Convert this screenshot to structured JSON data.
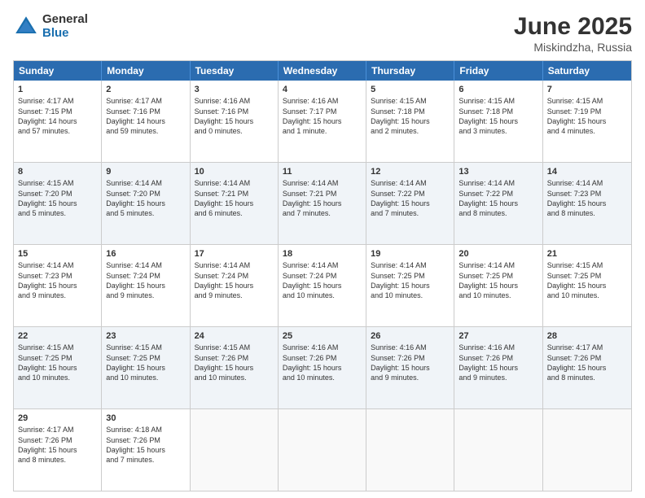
{
  "logo": {
    "general": "General",
    "blue": "Blue"
  },
  "title": "June 2025",
  "location": "Miskindzha, Russia",
  "header_days": [
    "Sunday",
    "Monday",
    "Tuesday",
    "Wednesday",
    "Thursday",
    "Friday",
    "Saturday"
  ],
  "rows": [
    [
      {
        "day": "1",
        "text": "Sunrise: 4:17 AM\nSunset: 7:15 PM\nDaylight: 14 hours\nand 57 minutes."
      },
      {
        "day": "2",
        "text": "Sunrise: 4:17 AM\nSunset: 7:16 PM\nDaylight: 14 hours\nand 59 minutes."
      },
      {
        "day": "3",
        "text": "Sunrise: 4:16 AM\nSunset: 7:16 PM\nDaylight: 15 hours\nand 0 minutes."
      },
      {
        "day": "4",
        "text": "Sunrise: 4:16 AM\nSunset: 7:17 PM\nDaylight: 15 hours\nand 1 minute."
      },
      {
        "day": "5",
        "text": "Sunrise: 4:15 AM\nSunset: 7:18 PM\nDaylight: 15 hours\nand 2 minutes."
      },
      {
        "day": "6",
        "text": "Sunrise: 4:15 AM\nSunset: 7:18 PM\nDaylight: 15 hours\nand 3 minutes."
      },
      {
        "day": "7",
        "text": "Sunrise: 4:15 AM\nSunset: 7:19 PM\nDaylight: 15 hours\nand 4 minutes."
      }
    ],
    [
      {
        "day": "8",
        "text": "Sunrise: 4:15 AM\nSunset: 7:20 PM\nDaylight: 15 hours\nand 5 minutes."
      },
      {
        "day": "9",
        "text": "Sunrise: 4:14 AM\nSunset: 7:20 PM\nDaylight: 15 hours\nand 5 minutes."
      },
      {
        "day": "10",
        "text": "Sunrise: 4:14 AM\nSunset: 7:21 PM\nDaylight: 15 hours\nand 6 minutes."
      },
      {
        "day": "11",
        "text": "Sunrise: 4:14 AM\nSunset: 7:21 PM\nDaylight: 15 hours\nand 7 minutes."
      },
      {
        "day": "12",
        "text": "Sunrise: 4:14 AM\nSunset: 7:22 PM\nDaylight: 15 hours\nand 7 minutes."
      },
      {
        "day": "13",
        "text": "Sunrise: 4:14 AM\nSunset: 7:22 PM\nDaylight: 15 hours\nand 8 minutes."
      },
      {
        "day": "14",
        "text": "Sunrise: 4:14 AM\nSunset: 7:23 PM\nDaylight: 15 hours\nand 8 minutes."
      }
    ],
    [
      {
        "day": "15",
        "text": "Sunrise: 4:14 AM\nSunset: 7:23 PM\nDaylight: 15 hours\nand 9 minutes."
      },
      {
        "day": "16",
        "text": "Sunrise: 4:14 AM\nSunset: 7:24 PM\nDaylight: 15 hours\nand 9 minutes."
      },
      {
        "day": "17",
        "text": "Sunrise: 4:14 AM\nSunset: 7:24 PM\nDaylight: 15 hours\nand 9 minutes."
      },
      {
        "day": "18",
        "text": "Sunrise: 4:14 AM\nSunset: 7:24 PM\nDaylight: 15 hours\nand 10 minutes."
      },
      {
        "day": "19",
        "text": "Sunrise: 4:14 AM\nSunset: 7:25 PM\nDaylight: 15 hours\nand 10 minutes."
      },
      {
        "day": "20",
        "text": "Sunrise: 4:14 AM\nSunset: 7:25 PM\nDaylight: 15 hours\nand 10 minutes."
      },
      {
        "day": "21",
        "text": "Sunrise: 4:15 AM\nSunset: 7:25 PM\nDaylight: 15 hours\nand 10 minutes."
      }
    ],
    [
      {
        "day": "22",
        "text": "Sunrise: 4:15 AM\nSunset: 7:25 PM\nDaylight: 15 hours\nand 10 minutes."
      },
      {
        "day": "23",
        "text": "Sunrise: 4:15 AM\nSunset: 7:25 PM\nDaylight: 15 hours\nand 10 minutes."
      },
      {
        "day": "24",
        "text": "Sunrise: 4:15 AM\nSunset: 7:26 PM\nDaylight: 15 hours\nand 10 minutes."
      },
      {
        "day": "25",
        "text": "Sunrise: 4:16 AM\nSunset: 7:26 PM\nDaylight: 15 hours\nand 10 minutes."
      },
      {
        "day": "26",
        "text": "Sunrise: 4:16 AM\nSunset: 7:26 PM\nDaylight: 15 hours\nand 9 minutes."
      },
      {
        "day": "27",
        "text": "Sunrise: 4:16 AM\nSunset: 7:26 PM\nDaylight: 15 hours\nand 9 minutes."
      },
      {
        "day": "28",
        "text": "Sunrise: 4:17 AM\nSunset: 7:26 PM\nDaylight: 15 hours\nand 8 minutes."
      }
    ],
    [
      {
        "day": "29",
        "text": "Sunrise: 4:17 AM\nSunset: 7:26 PM\nDaylight: 15 hours\nand 8 minutes."
      },
      {
        "day": "30",
        "text": "Sunrise: 4:18 AM\nSunset: 7:26 PM\nDaylight: 15 hours\nand 7 minutes."
      },
      {
        "day": "",
        "text": ""
      },
      {
        "day": "",
        "text": ""
      },
      {
        "day": "",
        "text": ""
      },
      {
        "day": "",
        "text": ""
      },
      {
        "day": "",
        "text": ""
      }
    ]
  ]
}
